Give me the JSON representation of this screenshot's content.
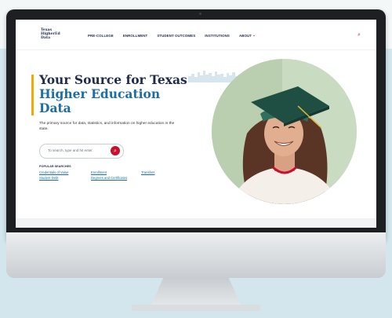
{
  "site": {
    "logo_lines": [
      "Texas",
      "HigherEd",
      "Data"
    ],
    "nav": {
      "items": [
        "PRE-COLLEGE",
        "ENROLLMENT",
        "STUDENT OUTCOMES",
        "INSTITUTIONS",
        "ABOUT"
      ]
    },
    "hero": {
      "title_line1": "Your Source for Texas",
      "title_line2": "Higher Education",
      "title_line3": "Data",
      "description": "The primary source for data, statistics, and information on higher education in the state."
    },
    "search": {
      "placeholder": "To search, type and hit enter."
    },
    "popular": {
      "label": "POPULAR SEARCHES",
      "links": [
        "Credentials of Value",
        "Enrollment",
        "Transfers",
        "Student Debt",
        "Degrees and Certificates"
      ]
    }
  },
  "colors": {
    "navy": "#1e2b4d",
    "blue": "#1b6ea8",
    "accent_red": "#c8102e",
    "accent_gold": "#f2a900"
  }
}
